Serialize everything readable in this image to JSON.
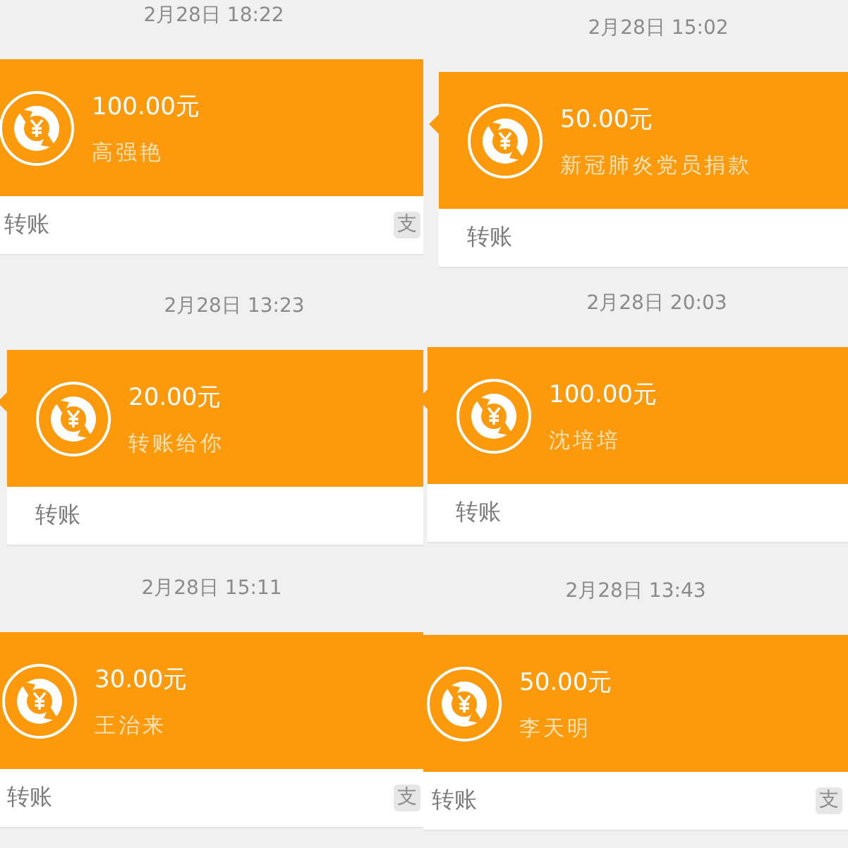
{
  "tiles": [
    {
      "time": "2月28日 18:22",
      "amount": "100.00元",
      "note": "高强艳",
      "label": "转账",
      "badge": "支"
    },
    {
      "time": "2月28日 15:02",
      "amount": "50.00元",
      "note": "新冠肺炎党员捐款",
      "label": "转账"
    },
    {
      "time": "2月28日 13:23",
      "amount": "20.00元",
      "note": "转账给你",
      "label": "转账"
    },
    {
      "time": "2月28日 20:03",
      "amount": "100.00元",
      "note": "沈培培",
      "label": "转账"
    },
    {
      "time": "2月28日 15:11",
      "amount": "30.00元",
      "note": "王治来",
      "label": "转账",
      "badge": "支"
    },
    {
      "time": "2月28日 13:43",
      "amount": "50.00元",
      "note": "李天明",
      "label": "转账",
      "badge": "支"
    }
  ]
}
